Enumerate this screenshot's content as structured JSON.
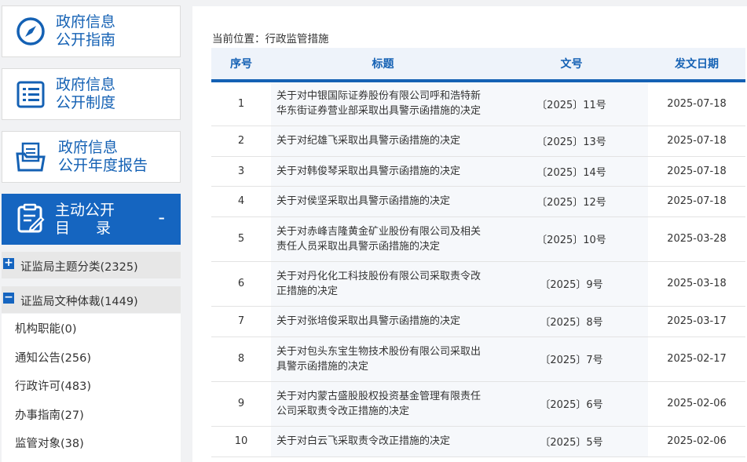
{
  "sidebar": {
    "cards": [
      {
        "line1": "政府信息",
        "line2": "公开指南",
        "icon": "compass-icon"
      },
      {
        "line1": "政府信息",
        "line2": "公开制度",
        "icon": "list-icon"
      },
      {
        "line1": "政府信息",
        "line2": "公开年度报告",
        "icon": "folder-doc-icon"
      }
    ],
    "active": {
      "line1": "主动公开",
      "line2a": "目",
      "line2b": "录",
      "toggle": "-",
      "icon": "edit-doc-icon"
    },
    "tree": [
      {
        "label": "证监局主题分类(2325)",
        "toggle": "+"
      },
      {
        "label": "证监局文种体裁(1449)",
        "toggle": "−"
      }
    ],
    "sub_items": [
      "机构职能(0)",
      "通知公告(256)",
      "行政许可(483)",
      "办事指南(27)",
      "监管对象(38)"
    ]
  },
  "breadcrumb": "当前位置：行政监管措施",
  "table": {
    "headers": [
      "序号",
      "标题",
      "文号",
      "发文日期"
    ],
    "rows": [
      {
        "idx": "1",
        "title": "关于对中银国际证券股份有限公司呼和浩特新华东街证券营业部采取出具警示函措施的决定",
        "doc": "〔2025〕11号",
        "date": "2025-07-18"
      },
      {
        "idx": "2",
        "title": "关于对纪雄飞采取出具警示函措施的决定",
        "doc": "〔2025〕13号",
        "date": "2025-07-18"
      },
      {
        "idx": "3",
        "title": "关于对韩俊琴采取出具警示函措施的决定",
        "doc": "〔2025〕14号",
        "date": "2025-07-18"
      },
      {
        "idx": "4",
        "title": "关于对侯坚采取出具警示函措施的决定",
        "doc": "〔2025〕12号",
        "date": "2025-07-18"
      },
      {
        "idx": "5",
        "title": "关于对赤峰吉隆黄金矿业股份有限公司及相关责任人员采取出具警示函措施的决定",
        "doc": "〔2025〕10号",
        "date": "2025-03-28"
      },
      {
        "idx": "6",
        "title": "关于对丹化化工科技股份有限公司采取责令改正措施的决定",
        "doc": "〔2025〕9号",
        "date": "2025-03-18"
      },
      {
        "idx": "7",
        "title": "关于对张培俊采取出具警示函措施的决定",
        "doc": "〔2025〕8号",
        "date": "2025-03-17"
      },
      {
        "idx": "8",
        "title": "关于对包头东宝生物技术股份有限公司采取出具警示函措施的决定",
        "doc": "〔2025〕7号",
        "date": "2025-02-17"
      },
      {
        "idx": "9",
        "title": "关于对内蒙古盛股股权投资基金管理有限责任公司采取责令改正措施的决定",
        "doc": "〔2025〕6号",
        "date": "2025-02-06"
      },
      {
        "idx": "10",
        "title": "关于对白云飞采取责令改正措施的决定",
        "doc": "〔2025〕5号",
        "date": "2025-02-06"
      }
    ]
  },
  "colors": {
    "brand": "#1565c0",
    "text_blue": "#1461b4"
  }
}
